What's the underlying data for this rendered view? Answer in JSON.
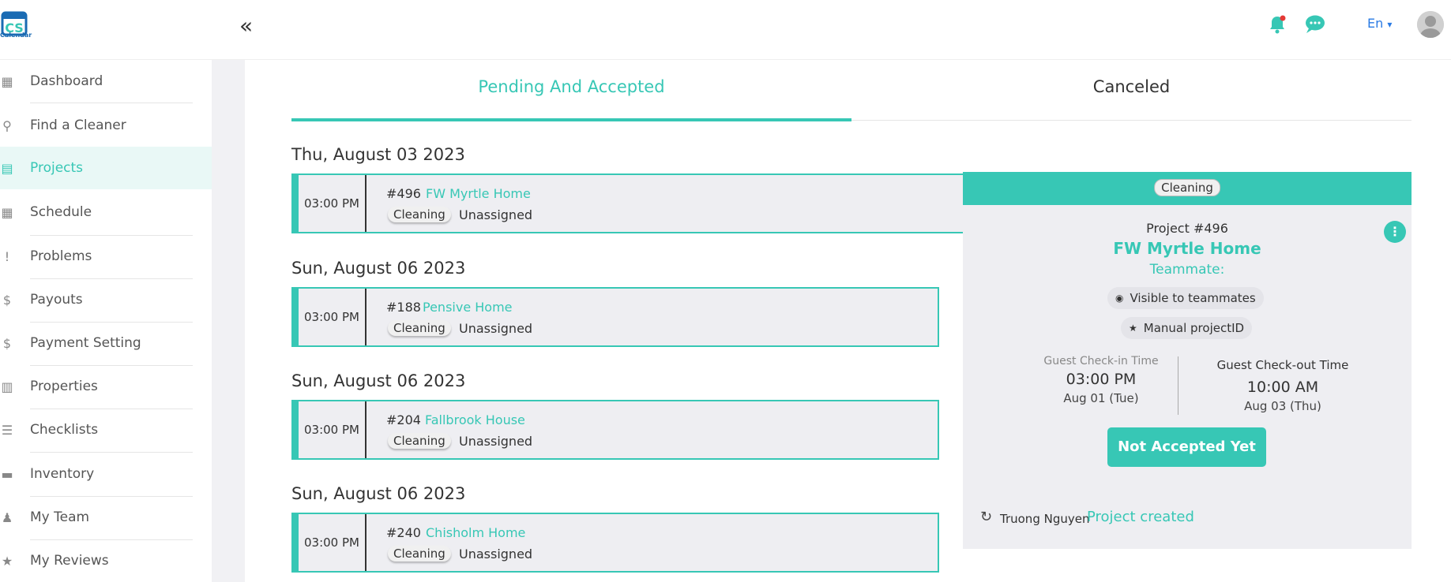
{
  "topbar": {
    "logo_text": "Calendar",
    "collapse_icon": "double-chevron-left-icon",
    "collapse_glyph": "«",
    "language": "En",
    "language_caret": "▾"
  },
  "sidebar": {
    "items": [
      {
        "label": "Dashboard",
        "icon": "grid-icon",
        "glyph": "▦"
      },
      {
        "label": "Find a Cleaner",
        "icon": "search-icon",
        "glyph": "⚲"
      },
      {
        "label": "Projects",
        "icon": "calendar-list-icon",
        "glyph": "▤"
      },
      {
        "label": "Schedule",
        "icon": "calendar-icon",
        "glyph": "▦"
      },
      {
        "label": "Problems",
        "icon": "exclamation-circle-icon",
        "glyph": "!"
      },
      {
        "label": "Payouts",
        "icon": "dollar-circle-icon",
        "glyph": "$"
      },
      {
        "label": "Payment Setting",
        "icon": "dollar-circle-icon",
        "glyph": "$"
      },
      {
        "label": "Properties",
        "icon": "building-icon",
        "glyph": "▥"
      },
      {
        "label": "Checklists",
        "icon": "clipboard-icon",
        "glyph": "☰"
      },
      {
        "label": "Inventory",
        "icon": "box-icon",
        "glyph": "▬"
      },
      {
        "label": "My Team",
        "icon": "users-icon",
        "glyph": "♟"
      },
      {
        "label": "My Reviews",
        "icon": "star-icon",
        "glyph": "★"
      }
    ],
    "active_index": 2
  },
  "tabs": {
    "pending": "Pending And Accepted",
    "canceled": "Canceled"
  },
  "projects": [
    {
      "date": "Thu, August 03 2023",
      "time": "03:00 PM",
      "number": "#496",
      "name": "FW Myrtle Home",
      "type": "Cleaning",
      "assignee": "Unassigned"
    },
    {
      "date": "Sun, August 06 2023",
      "time": "03:00 PM",
      "number": "#188",
      "name": "Pensive Home",
      "type": "Cleaning",
      "assignee": "Unassigned"
    },
    {
      "date": "Sun, August 06 2023",
      "time": "03:00 PM",
      "number": "#204",
      "name": "Fallbrook House",
      "type": "Cleaning",
      "assignee": "Unassigned"
    },
    {
      "date": "Sun, August 06 2023",
      "time": "03:00 PM",
      "number": "#240",
      "name": "Chisholm Home",
      "type": "Cleaning",
      "assignee": "Unassigned"
    }
  ],
  "detail": {
    "type": "Cleaning",
    "project_label": "Project #496",
    "project_name": "FW Myrtle Home",
    "teammate_label": "Teammate:",
    "visible_label": "Visible to teammates",
    "manual_label": "Manual projectID",
    "checkin_label": "Guest Check-in Time",
    "checkin_time": "03:00 PM",
    "checkin_date": "Aug 01 (Tue)",
    "checkout_label": "Guest Check-out Time",
    "checkout_time": "10:00 AM",
    "checkout_date": "Aug 03 (Thu)",
    "status_button": "Not Accepted Yet",
    "activity_user": "Truong Nguyen",
    "activity_text": "Project created"
  },
  "colors": {
    "accent": "#37c7b5",
    "link_blue": "#2a7be4",
    "notification_dot": "#e53935"
  }
}
